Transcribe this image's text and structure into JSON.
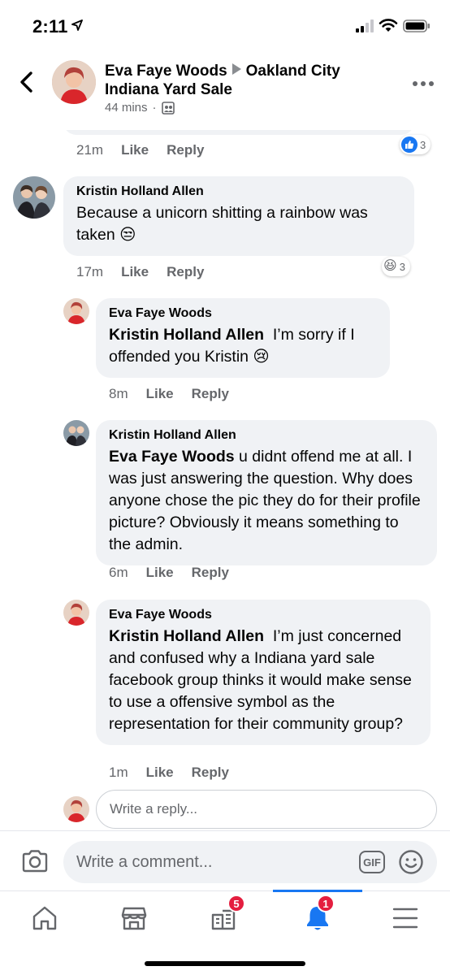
{
  "status_bar": {
    "time": "2:11"
  },
  "header": {
    "author": "Eva Faye Woods",
    "group": "Oakland City Indiana Yard Sale",
    "time": "44 mins",
    "separator": "·"
  },
  "comments": {
    "prev_meta": {
      "time": "21m",
      "like": "Like",
      "reply": "Reply",
      "reaction_count": "3"
    },
    "items": [
      {
        "author": "Kristin Holland Allen",
        "text": "Because a unicorn shitting a rainbow was taken 😒",
        "time": "17m",
        "like": "Like",
        "reply": "Reply",
        "reaction_emoji": "😆",
        "reaction_count": "3"
      },
      {
        "author": "Eva Faye Woods",
        "mention": "Kristin Holland Allen",
        "text": "I’m sorry if I offended you Kristin 😢",
        "time": "8m",
        "like": "Like",
        "reply": "Reply"
      },
      {
        "author": "Kristin Holland Allen",
        "mention": "Eva Faye Woods",
        "text": "u didnt offend me at all. I was just answering the question. Why does anyone chose the pic they do for their profile picture? Obviously it means something to the admin.",
        "time": "6m",
        "like": "Like",
        "reply": "Reply"
      },
      {
        "author": "Eva Faye Woods",
        "mention": "Kristin Holland Allen",
        "text": "I’m just concerned and confused why a Indiana yard sale facebook group thinks it would make sense to use a offensive symbol as the representation for their community group?",
        "time": "1m",
        "like": "Like",
        "reply": "Reply"
      }
    ],
    "reply_placeholder": "Write a reply..."
  },
  "composer": {
    "placeholder": "Write a comment...",
    "gif_label": "GIF"
  },
  "tabs": {
    "groups_badge": "5",
    "notifications_badge": "1"
  },
  "colors": {
    "accent": "#1877f2",
    "badge": "#e41e3f",
    "bubble": "#f0f2f5"
  }
}
